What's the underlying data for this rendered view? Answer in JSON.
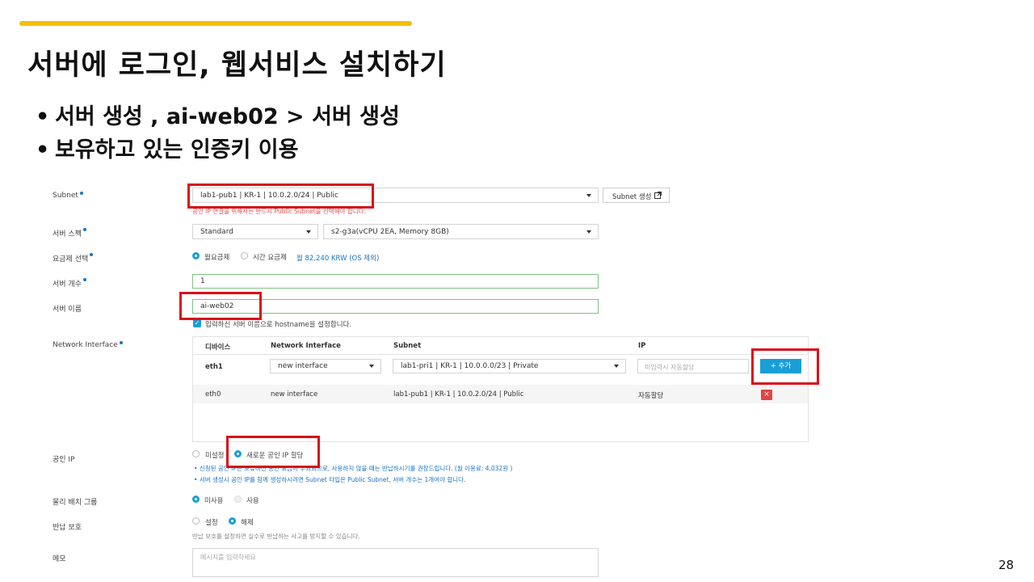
{
  "slide": {
    "title": "서버에 로그인, 웹서비스 설치하기",
    "bullets": [
      "서버 생성 , ai-web02 > 서버 생성",
      "보유하고 있는 인증키 이용"
    ],
    "page_number": "28",
    "accent_color": "#f5c000"
  },
  "form": {
    "subnet": {
      "label": "Subnet",
      "value": "lab1-pub1 | KR-1 | 10.0.2.0/24 | Public",
      "create_button": "Subnet 생성",
      "warning": "공인 IP 연결을 위해서는 반드시 Public Subnet을 선택해야 합니다."
    },
    "spec": {
      "label": "서버 스펙",
      "type_value": "Standard",
      "size_value": "s2-g3a(vCPU 2EA, Memory 8GB)"
    },
    "billing": {
      "label": "요금제 선택",
      "options": [
        "월요금제",
        "시간 요금제"
      ],
      "selected": "월요금제",
      "price": "월 82,240 KRW (OS 제외)"
    },
    "count": {
      "label": "서버 개수",
      "value": "1"
    },
    "name": {
      "label": "서버 이름",
      "value": "ai-web02",
      "hostname_check": "입력하신 서버 이름으로 hostname을 설정합니다."
    },
    "network": {
      "label": "Network Interface",
      "headers": [
        "디바이스",
        "Network Interface",
        "Subnet",
        "IP"
      ],
      "new_row": {
        "device": "eth1",
        "interface": "new interface",
        "subnet": "lab1-pri1 | KR-1 | 10.0.0.0/23 | Private",
        "ip_placeholder": "미입력시 자동할당",
        "add_button": "+ 추가"
      },
      "rows": [
        {
          "device": "eth0",
          "interface": "new interface",
          "subnet": "lab1-pub1 | KR-1 | 10.0.2.0/24 | Public",
          "ip": "자동할당",
          "delete": "×"
        }
      ]
    },
    "public_ip": {
      "label": "공인 IP",
      "options": [
        "미설정",
        "새로운 공인 IP 할당"
      ],
      "selected": "새로운 공인 IP 할당",
      "notes": [
        "신청된 공인 IP는 보유하신 동안 요금이 부과되므로, 사용하지 않을 때는 반납하시기를 권장드립니다. (월 이용료: 4,032원 )",
        "서버 생성시 공인 IP를 함께 생성하시려면 Subnet 타입은 Public Subnet, 서버 개수는 1개여야 합니다."
      ]
    },
    "placement": {
      "label": "물리 배치 그룹",
      "options": [
        "미사용",
        "사용"
      ],
      "selected": "미사용"
    },
    "protection": {
      "label": "반납 보호",
      "options": [
        "설정",
        "해제"
      ],
      "selected": "해제",
      "hint": "반납 보호를 설정하면 실수로 반납하는 사고를 방지할 수 있습니다."
    },
    "memo": {
      "label": "메모",
      "placeholder": "메시지를 입력하세요"
    }
  }
}
